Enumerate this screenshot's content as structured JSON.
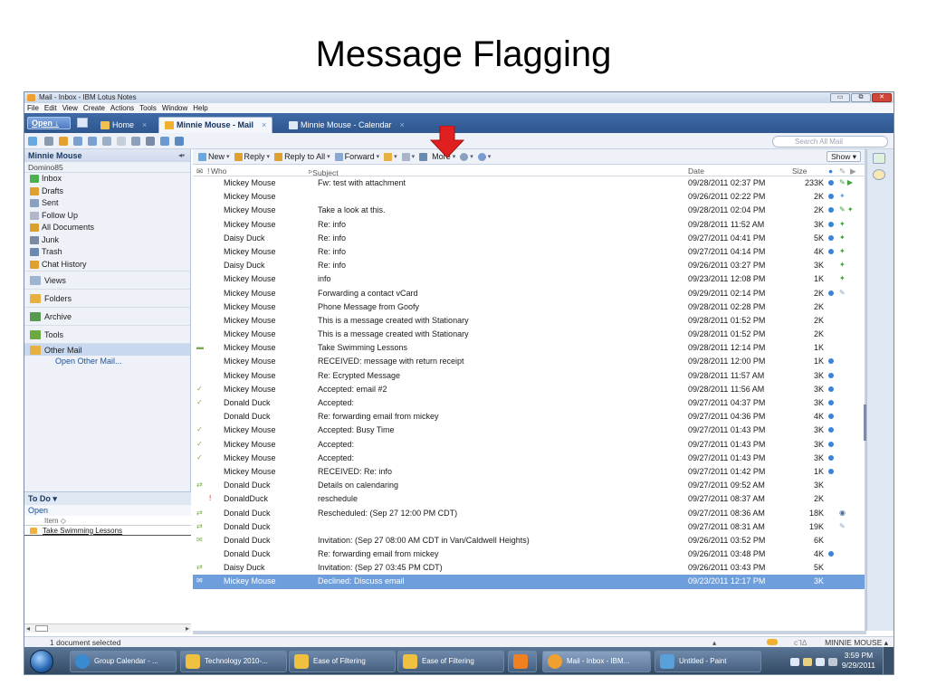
{
  "slide": {
    "title": "Message Flagging"
  },
  "window": {
    "title": "Mail - Inbox - IBM Lotus Notes",
    "controls": {
      "minimize": "▭",
      "maximize": "⧉",
      "close": "✕"
    }
  },
  "menu": [
    "File",
    "Edit",
    "View",
    "Create",
    "Actions",
    "Tools",
    "Window",
    "Help"
  ],
  "tabs": {
    "open_label": "Open ↓",
    "home": "Home",
    "mail": "Minnie Mouse - Mail",
    "calendar": "Minnie Mouse - Calendar",
    "close_glyph": "×"
  },
  "search": {
    "placeholder": "Search All Mail"
  },
  "sidebar": {
    "owner": "Minnie Mouse",
    "server": "Domino85",
    "collapse": "◂▪",
    "folders": [
      {
        "label": "Inbox",
        "icon": "inbox-icon",
        "color": "#4caf50"
      },
      {
        "label": "Drafts",
        "icon": "drafts-icon",
        "color": "#e0a030"
      },
      {
        "label": "Sent",
        "icon": "sent-icon",
        "color": "#8aa0c0"
      },
      {
        "label": "Follow Up",
        "icon": "flag-icon",
        "color": "#b0b8c8"
      },
      {
        "label": "All Documents",
        "icon": "all-documents-icon",
        "color": "#d9a030"
      },
      {
        "label": "Junk",
        "icon": "junk-icon",
        "color": "#7a8aa0"
      },
      {
        "label": "Trash",
        "icon": "trash-icon",
        "color": "#6a8ab0"
      },
      {
        "label": "Chat History",
        "icon": "chat-history-icon",
        "color": "#e0a030"
      }
    ],
    "groups": [
      {
        "label": "Views",
        "icon": "views-icon",
        "color": "#9fb3d2"
      },
      {
        "label": "Folders",
        "icon": "folders-icon",
        "color": "#e8b040"
      },
      {
        "label": "Archive",
        "icon": "archive-icon",
        "color": "#5a9a50"
      },
      {
        "label": "Tools",
        "icon": "tools-icon",
        "color": "#6aaa40"
      },
      {
        "label": "Other Mail",
        "icon": "other-mail-icon",
        "color": "#e8b040"
      }
    ],
    "open_other_mail": "Open Other Mail..."
  },
  "todo": {
    "header": "To Do ▾",
    "section": "Open",
    "column": "Item ◇",
    "items": [
      "Take Swimming Lessons"
    ]
  },
  "actions": {
    "new": "New",
    "reply": "Reply",
    "reply_all": "Reply to All",
    "forward": "Forward",
    "more": "More",
    "show": "Show"
  },
  "columns": {
    "who": "Who",
    "subject": "Subject",
    "date": "Date",
    "size": "Size"
  },
  "messages": [
    {
      "who": "Mickey Mouse",
      "subject": "Fw: test with attachment",
      "date": "09/28/2011 02:37 PM",
      "size": "233K",
      "unread": true,
      "marks": "✎ ▶",
      "marks_color": "#3aa03a",
      "lead": ""
    },
    {
      "who": "Mickey Mouse",
      "subject": "",
      "date": "09/26/2011 02:22 PM",
      "size": "2K",
      "unread": true,
      "marks": "✦",
      "marks_color": "#6a9ae0",
      "lead": ""
    },
    {
      "who": "Mickey Mouse",
      "subject": "Take a look at this.",
      "date": "09/28/2011 02:04 PM",
      "size": "2K",
      "unread": true,
      "marks": "✎ ✦",
      "marks_color": "#3aa03a",
      "lead": ""
    },
    {
      "who": "Mickey Mouse",
      "subject": "Re: info",
      "date": "09/28/2011 11:52 AM",
      "size": "3K",
      "unread": true,
      "marks": "✦",
      "marks_color": "#3aa03a",
      "lead": ""
    },
    {
      "who": "Daisy Duck",
      "subject": "Re: info",
      "date": "09/27/2011 04:41 PM",
      "size": "5K",
      "unread": true,
      "marks": "✦",
      "marks_color": "#3aa03a",
      "lead": ""
    },
    {
      "who": "Mickey Mouse",
      "subject": "Re: info",
      "date": "09/27/2011 04:14 PM",
      "size": "4K",
      "unread": true,
      "marks": "✦",
      "marks_color": "#3aa03a",
      "lead": ""
    },
    {
      "who": "Daisy Duck",
      "subject": "Re: info",
      "date": "09/26/2011 03:27 PM",
      "size": "3K",
      "unread": false,
      "marks": "✦",
      "marks_color": "#3aa03a",
      "lead": ""
    },
    {
      "who": "Mickey Mouse",
      "subject": "info",
      "date": "09/23/2011 12:08 PM",
      "size": "1K",
      "unread": false,
      "marks": "✦",
      "marks_color": "#3aa03a",
      "lead": ""
    },
    {
      "who": "Mickey Mouse",
      "subject": "Forwarding a contact vCard",
      "date": "09/29/2011 02:14 PM",
      "size": "2K",
      "unread": true,
      "marks": "✎",
      "marks_color": "#8aa0c0",
      "lead": ""
    },
    {
      "who": "Mickey Mouse",
      "subject": "Phone Message from Goofy",
      "date": "09/28/2011 02:28 PM",
      "size": "2K",
      "unread": false,
      "marks": "",
      "marks_color": "#000000",
      "lead": ""
    },
    {
      "who": "Mickey Mouse",
      "subject": "This is a message created with Stationary",
      "date": "09/28/2011 01:52 PM",
      "size": "2K",
      "unread": false,
      "marks": "",
      "marks_color": "#000000",
      "lead": ""
    },
    {
      "who": "Mickey Mouse",
      "subject": "This is a message created with Stationary",
      "date": "09/28/2011 01:52 PM",
      "size": "2K",
      "unread": false,
      "marks": "",
      "marks_color": "#000000",
      "lead": ""
    },
    {
      "who": "Mickey Mouse",
      "subject": "Take Swimming Lessons",
      "date": "09/28/2011 12:14 PM",
      "size": "1K",
      "unread": false,
      "marks": "",
      "marks_color": "#000000",
      "lead": "▬"
    },
    {
      "who": "Mickey Mouse",
      "subject": "RECEIVED: message with return receipt",
      "date": "09/28/2011 12:00 PM",
      "size": "1K",
      "unread": true,
      "marks": "",
      "marks_color": "#000000",
      "lead": ""
    },
    {
      "who": "Mickey Mouse",
      "subject": "Re: Ecrypted Message",
      "date": "09/28/2011 11:57 AM",
      "size": "3K",
      "unread": true,
      "marks": "",
      "marks_color": "#000000",
      "lead": ""
    },
    {
      "who": "Mickey Mouse",
      "subject": "Accepted: email #2",
      "date": "09/28/2011 11:56 AM",
      "size": "3K",
      "unread": true,
      "marks": "",
      "marks_color": "#000000",
      "lead": "✓"
    },
    {
      "who": "Donald Duck",
      "subject": "Accepted:",
      "date": "09/27/2011 04:37 PM",
      "size": "3K",
      "unread": true,
      "marks": "",
      "marks_color": "#000000",
      "lead": "✓"
    },
    {
      "who": "Donald Duck",
      "subject": "Re: forwarding email from mickey",
      "date": "09/27/2011 04:36 PM",
      "size": "4K",
      "unread": true,
      "marks": "",
      "marks_color": "#000000",
      "lead": ""
    },
    {
      "who": "Mickey Mouse",
      "subject": "Accepted: Busy Time",
      "date": "09/27/2011 01:43 PM",
      "size": "3K",
      "unread": true,
      "marks": "",
      "marks_color": "#000000",
      "lead": "✓"
    },
    {
      "who": "Mickey Mouse",
      "subject": "Accepted:",
      "date": "09/27/2011 01:43 PM",
      "size": "3K",
      "unread": true,
      "marks": "",
      "marks_color": "#000000",
      "lead": "✓"
    },
    {
      "who": "Mickey Mouse",
      "subject": "Accepted:",
      "date": "09/27/2011 01:43 PM",
      "size": "3K",
      "unread": true,
      "marks": "",
      "marks_color": "#000000",
      "lead": "✓"
    },
    {
      "who": "Mickey Mouse",
      "subject": "RECEIVED: Re: info",
      "date": "09/27/2011 01:42 PM",
      "size": "1K",
      "unread": true,
      "marks": "",
      "marks_color": "#000000",
      "lead": ""
    },
    {
      "who": "Donald Duck",
      "subject": "Details on calendaring",
      "date": "09/27/2011 09:52 AM",
      "size": "3K",
      "unread": false,
      "marks": "",
      "marks_color": "#000000",
      "lead": "⇄"
    },
    {
      "who": "DonaldDuck",
      "subject": "reschedule",
      "date": "09/27/2011 08:37 AM",
      "size": "2K",
      "unread": false,
      "marks": "",
      "marks_color": "#000000",
      "lead": "!"
    },
    {
      "who": "Donald Duck",
      "subject": "Rescheduled:  (Sep 27 12:00 PM CDT)",
      "date": "09/27/2011 08:36 AM",
      "size": "18K",
      "unread": false,
      "marks": "◉",
      "marks_color": "#4a6aa0",
      "lead": "⇄"
    },
    {
      "who": "Donald Duck",
      "subject": "",
      "date": "09/27/2011 08:31 AM",
      "size": "19K",
      "unread": false,
      "marks": "✎",
      "marks_color": "#8aa0c0",
      "lead": "⇄"
    },
    {
      "who": "Donald Duck",
      "subject": "Invitation:  (Sep 27 08:00 AM CDT in Van/Caldwell Heights)",
      "date": "09/26/2011 03:52 PM",
      "size": "6K",
      "unread": false,
      "marks": "",
      "marks_color": "#000000",
      "lead": "✉"
    },
    {
      "who": "Donald Duck",
      "subject": "Re: forwarding email from mickey",
      "date": "09/26/2011 03:48 PM",
      "size": "4K",
      "unread": true,
      "marks": "",
      "marks_color": "#000000",
      "lead": ""
    },
    {
      "who": "Daisy Duck",
      "subject": "Invitation:  (Sep 27 03:45 PM CDT)",
      "date": "09/26/2011 03:43 PM",
      "size": "5K",
      "unread": false,
      "marks": "",
      "marks_color": "#000000",
      "lead": "⇄"
    },
    {
      "who": "Mickey Mouse",
      "subject": "Declined: Discuss email",
      "date": "09/23/2011 12:17 PM",
      "size": "3K",
      "unread": false,
      "marks": "",
      "marks_color": "#000000",
      "lead": "✉",
      "selected": true
    }
  ],
  "status": {
    "left": "1 document selected",
    "right": "MINNIE MOUSE ▴",
    "up": "▴",
    "ca": "c⅂∆"
  },
  "taskbar": {
    "items": [
      {
        "label": "Group Calendar - ...",
        "color": "#3a8ad0"
      },
      {
        "label": "Technology 2010-...",
        "color": "#f0c040"
      },
      {
        "label": "Ease of Filtering",
        "color": "#f0c040"
      },
      {
        "label": "Ease of Filtering",
        "color": "#f0c040"
      },
      {
        "label": "",
        "color": "#f08020"
      },
      {
        "label": "Mail - Inbox - IBM...",
        "color": "#f0a030"
      },
      {
        "label": "Untitled - Paint",
        "color": "#5aa0d8"
      }
    ],
    "time": "3:59 PM",
    "date": "9/29/2011"
  },
  "colors": {
    "accent": "#2f5790",
    "selection": "#6e9fdc",
    "unread": "#3b83d8",
    "annotation_arrow": "#e02020"
  }
}
